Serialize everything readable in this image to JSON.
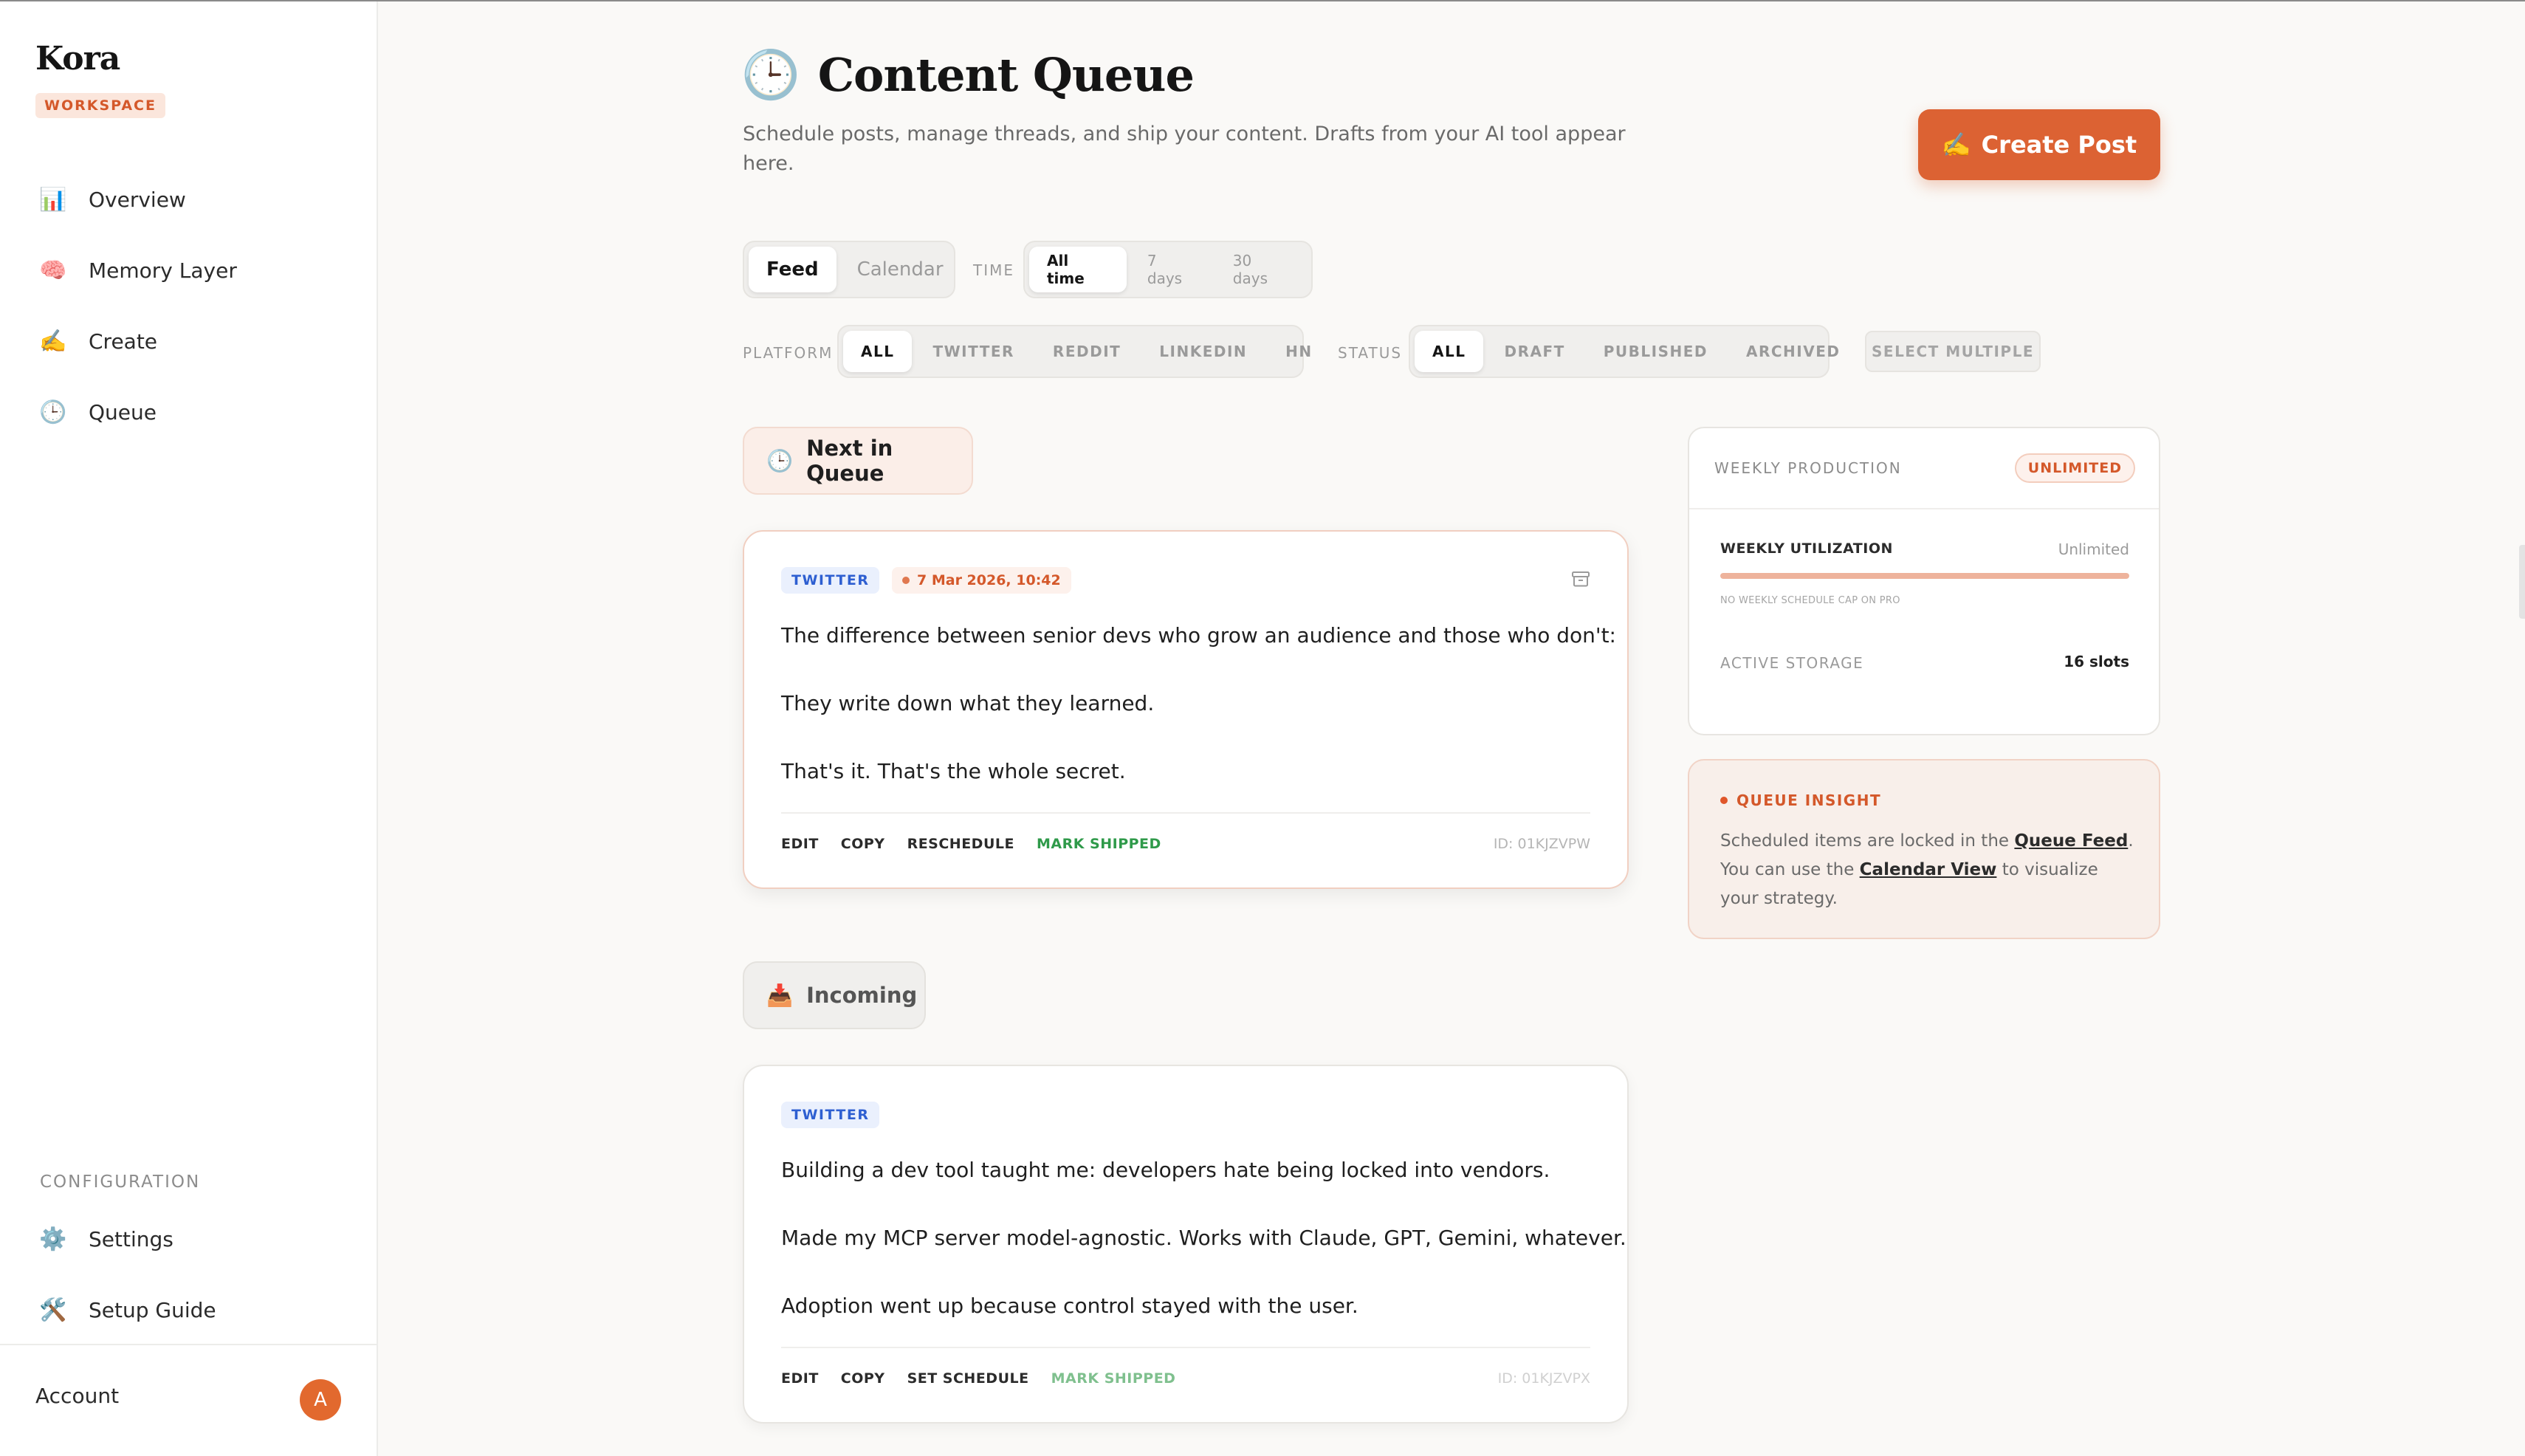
{
  "sidebar": {
    "brand": "Kora",
    "badge": "WORKSPACE",
    "nav": [
      {
        "label": "Overview",
        "icon": "📊"
      },
      {
        "label": "Memory Layer",
        "icon": "🧠"
      },
      {
        "label": "Create",
        "icon": "✍️"
      },
      {
        "label": "Queue",
        "icon": "🕒"
      }
    ],
    "config_label": "CONFIGURATION",
    "config_items": [
      {
        "label": "Settings",
        "icon": "⚙️"
      },
      {
        "label": "Setup Guide",
        "icon": "🛠️"
      }
    ],
    "account_label": "Account",
    "avatar_initial": "A"
  },
  "header": {
    "title_icon": "🕒",
    "title": "Content Queue",
    "subtitle": "Schedule posts, manage threads, and ship your content. Drafts from your AI tool appear here.",
    "create_icon": "✍️",
    "create_label": "Create Post"
  },
  "filters": {
    "view": [
      "Feed",
      "Calendar"
    ],
    "time_label": "TIME",
    "time": [
      "All time",
      "7 days",
      "30 days"
    ],
    "platform_label": "PLATFORM",
    "platform": [
      "ALL",
      "TWITTER",
      "REDDIT",
      "LINKEDIN",
      "HN"
    ],
    "status_label": "STATUS",
    "status": [
      "ALL",
      "DRAFT",
      "PUBLISHED",
      "ARCHIVED"
    ],
    "select_multiple": "SELECT MULTIPLE"
  },
  "next": {
    "icon": "🕒",
    "label": "Next in Queue",
    "post": {
      "platform": "TWITTER",
      "date": "7 Mar 2026, 10:42",
      "lines": [
        "The difference between senior devs who grow an audience and those who don't:",
        "They write down what they learned.",
        "That's it. That's the whole secret."
      ],
      "actions": [
        "EDIT",
        "COPY",
        "RESCHEDULE",
        "MARK SHIPPED"
      ],
      "id": "ID: 01KJZVPW"
    }
  },
  "incoming": {
    "icon": "📥",
    "label": "Incoming",
    "post": {
      "platform": "TWITTER",
      "lines": [
        "Building a dev tool taught me: developers hate being locked into vendors.",
        "Made my MCP server model-agnostic. Works with Claude, GPT, Gemini, whatever.",
        "Adoption went up because control stayed with the user."
      ],
      "actions": [
        "EDIT",
        "COPY",
        "SET SCHEDULE",
        "MARK SHIPPED"
      ],
      "id": "ID: 01KJZVPX"
    }
  },
  "weekly": {
    "title": "WEEKLY PRODUCTION",
    "badge": "UNLIMITED",
    "util_label": "WEEKLY UTILIZATION",
    "util_value": "Unlimited",
    "util_fill_percent": 100,
    "util_note": "NO WEEKLY SCHEDULE CAP ON PRO",
    "storage_label": "ACTIVE STORAGE",
    "storage_value": "16 slots"
  },
  "insight": {
    "title": "QUEUE INSIGHT",
    "text_1": "Scheduled items are locked in the ",
    "link_1": "Queue Feed",
    "text_2": ". You can use the ",
    "link_2": "Calendar View",
    "text_3": " to visualize your strategy."
  },
  "colors": {
    "accent": "#dc6233",
    "twitter_tag": "#2e5fd1",
    "shipped": "#2f9a4a"
  }
}
